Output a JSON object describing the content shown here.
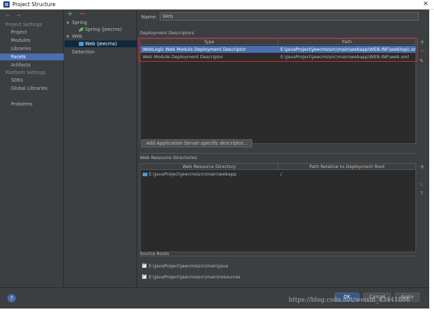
{
  "window": {
    "title": "Project Structure",
    "close_glyph": "×"
  },
  "nav": {
    "arrows": "← →",
    "project_settings_header": "Project Settings",
    "project_settings_items": [
      "Project",
      "Modules",
      "Libraries",
      "Facets",
      "Artifacts"
    ],
    "selected": "Facets",
    "platform_settings_header": "Platform Settings",
    "platform_settings_items": [
      "SDKs",
      "Global Libraries"
    ],
    "problems": "Problems"
  },
  "tree": {
    "add_glyph": "+",
    "remove_glyph": "−",
    "nodes": [
      {
        "label": "Spring",
        "level": 0,
        "expanded": true
      },
      {
        "label": "Spring (jeecms)",
        "level": 1
      },
      {
        "label": "Web",
        "level": 0,
        "expanded": true
      },
      {
        "label": "Web (jeecms)",
        "level": 1,
        "selected": true
      },
      {
        "label": "Detection",
        "level": 0
      }
    ]
  },
  "facet": {
    "name_label": "Name:",
    "name_value": "Web",
    "deployment_descriptors": {
      "title": "Deployment Descriptors",
      "columns": [
        "Type",
        "Path"
      ],
      "rows": [
        {
          "type": "WebLogic Web Module Deployment Descriptor",
          "path": "E:\\JavaProject\\jeecms\\src\\main\\webapp\\WEB-INF\\weblogic.xml",
          "selected": true
        },
        {
          "type": "Web Module Deployment Descriptor",
          "path": "E:\\JavaProject\\jeecms\\src\\main\\webapp\\WEB-INF\\web.xml",
          "selected": false
        }
      ]
    },
    "add_server_descriptor_button": "Add Application Server specific descriptor...",
    "web_resource_directories": {
      "title": "Web Resource Directories",
      "columns": [
        "Web Resource Directory",
        "Path Relative to Deployment Root"
      ],
      "rows": [
        {
          "directory": "E:\\JavaProject\\jeecms\\src\\main\\webapp",
          "relative": "/"
        }
      ]
    },
    "source_roots": {
      "title": "Source Roots",
      "items": [
        {
          "path": "E:\\JavaProject\\jeecms\\src\\main\\java",
          "checked": true
        },
        {
          "path": "E:\\JavaProject\\jeecms\\src\\main\\resources",
          "checked": true
        }
      ]
    }
  },
  "buttons": {
    "help": "?",
    "ok": "OK",
    "cancel": "Cancel",
    "apply": "Apply"
  },
  "watermark": "https://blog.csdn.net/weixin_43441866",
  "colors": {
    "background": "#3c3f41",
    "selection": "#4b6eaf",
    "highlight_box": "#e0262e",
    "add": "#59a869",
    "remove": "#c75450"
  }
}
